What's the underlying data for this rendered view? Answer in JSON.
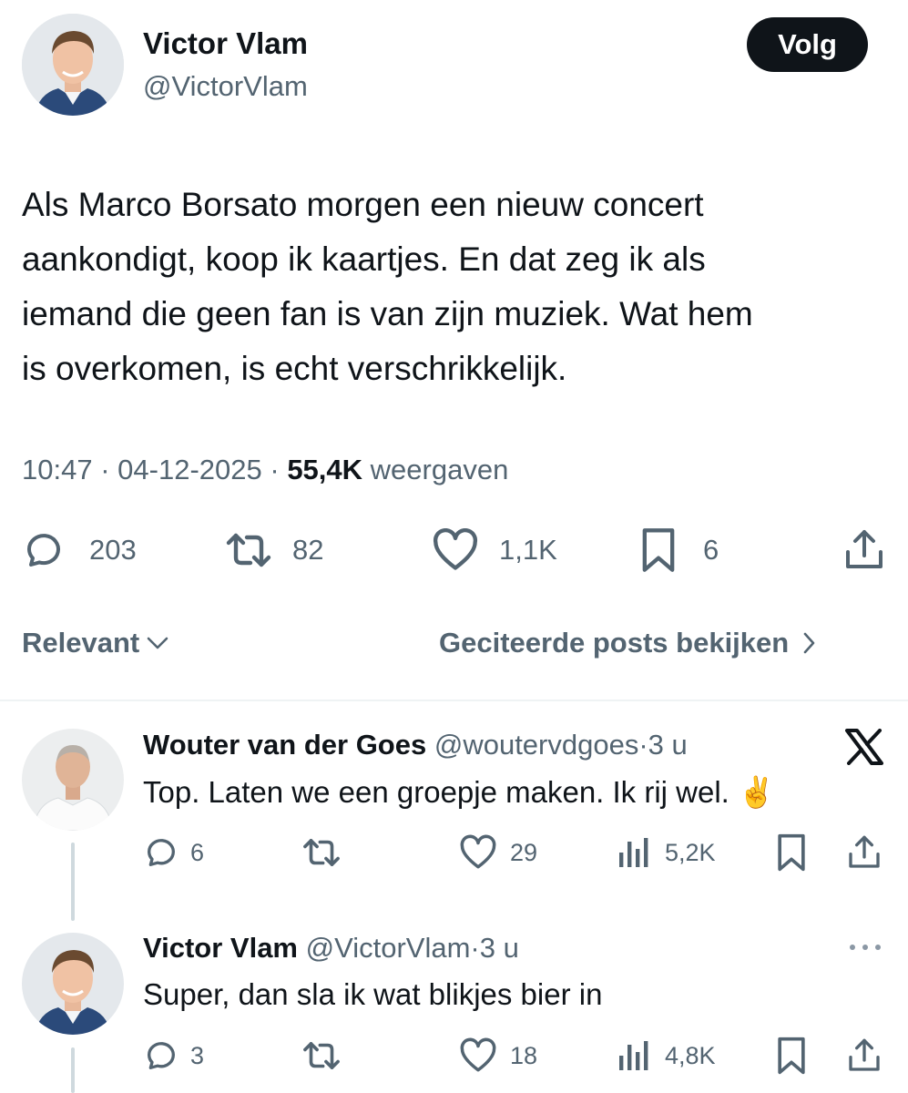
{
  "main_post": {
    "author_name": "Victor Vlam",
    "author_handle": "@VictorVlam",
    "follow_label": "Volg",
    "text_lines": [
      "Als Marco Borsato morgen een nieuw concert",
      "aankondigt, koop ik kaartjes. En dat zeg ik als",
      "iemand die geen fan is van zijn muziek. Wat hem",
      "is overkomen, is echt verschrikkelijk."
    ],
    "time": "10:47",
    "separator": "·",
    "date": "04-12-2025",
    "views_count": "55,4K",
    "views_label": "weergaven",
    "replies": "203",
    "reposts": "82",
    "likes": "1,1K",
    "bookmarks": "6"
  },
  "sort": {
    "label": "Relevant",
    "quotes_link": "Geciteerde posts bekijken"
  },
  "replies": [
    {
      "author_name": "Wouter van der Goes",
      "author_handle": "@woutervdgoes",
      "separator": "·",
      "age": "3 u",
      "text": "Top. Laten we een groepje maken. Ik rij wel. ✌️",
      "replies": "6",
      "reposts": "",
      "likes": "29",
      "views": "5,2K"
    },
    {
      "author_name": "Victor Vlam",
      "author_handle": "@VictorVlam",
      "separator": "·",
      "age": "3 u",
      "text": "Super, dan sla ik wat blikjes bier in",
      "replies": "3",
      "reposts": "",
      "likes": "18",
      "views": "4,8K"
    }
  ],
  "colors": {
    "text": "#0f1419",
    "muted": "#536471",
    "follow_bg": "#0f1419",
    "divider": "#eff3f4",
    "thread_line": "#cfd9de"
  }
}
